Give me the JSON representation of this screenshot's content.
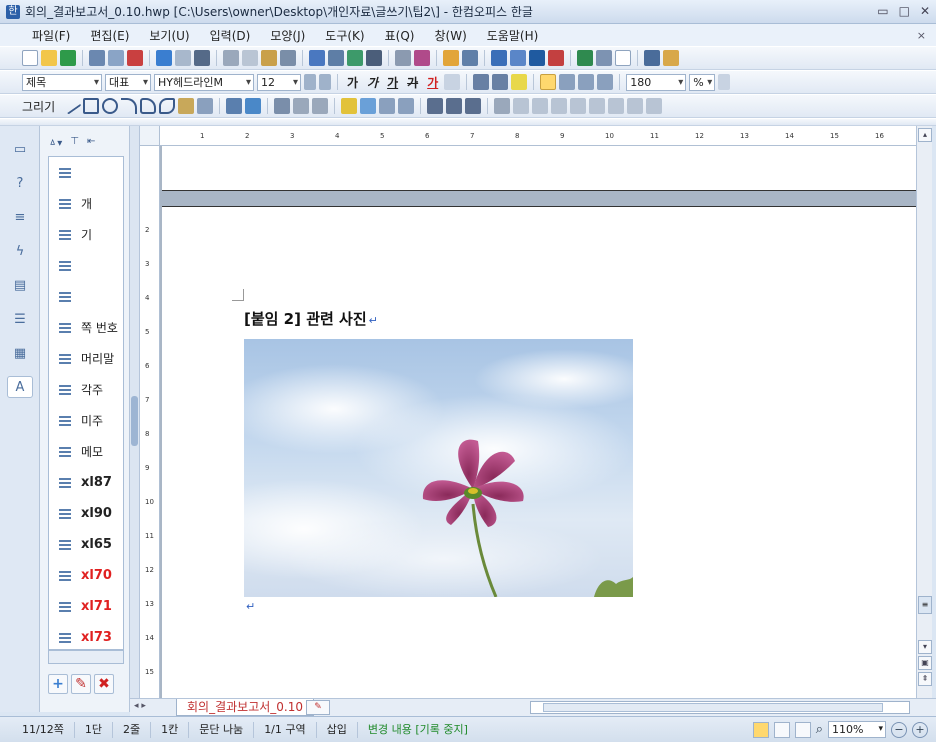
{
  "window": {
    "title": "회의_결과보고서_0.10.hwp [C:\\Users\\owner\\Desktop\\개인자료\\글쓰기\\팁2\\] - 한컴오피스 한글",
    "min_glyph": "▭",
    "max_glyph": "□",
    "close_glyph": "✕"
  },
  "menu": {
    "items": [
      "파일(F)",
      "편집(E)",
      "보기(U)",
      "입력(D)",
      "모양(J)",
      "도구(K)",
      "표(Q)",
      "창(W)",
      "도움말(H)"
    ],
    "close_doc": "×"
  },
  "format_toolbar": {
    "style": "제목",
    "lang": "대표",
    "font": "HY헤드라인M",
    "size": "12",
    "bold": "가",
    "italic": "가",
    "underline": "가",
    "strike": "가",
    "color_char": "가",
    "line_spacing": "180",
    "percent": "%"
  },
  "draw_toolbar": {
    "label": "그리기"
  },
  "style_panel": {
    "items": [
      {
        "label": "",
        "style": "normal"
      },
      {
        "label": "개",
        "style": "normal"
      },
      {
        "label": "기",
        "style": "normal"
      },
      {
        "label": "",
        "style": "normal"
      },
      {
        "label": "",
        "style": "normal"
      },
      {
        "label": "쪽 번호",
        "style": "normal"
      },
      {
        "label": "머리말",
        "style": "normal"
      },
      {
        "label": "각주",
        "style": "normal"
      },
      {
        "label": "미주",
        "style": "normal"
      },
      {
        "label": "메모",
        "style": "normal"
      },
      {
        "label": "xl87",
        "style": "bold"
      },
      {
        "label": "xl90",
        "style": "bold"
      },
      {
        "label": "xl65",
        "style": "bold"
      },
      {
        "label": "xl70",
        "style": "red"
      },
      {
        "label": "xl71",
        "style": "red"
      },
      {
        "label": "xl73",
        "style": "red"
      }
    ],
    "add_btn": "+",
    "edit_btn": "✎",
    "delete_btn": "✖"
  },
  "document": {
    "heading": "[붙임 2] 관련 사진",
    "para_mark": "↵",
    "after_mark": "↵"
  },
  "tabs": {
    "doc_tab": "회의_결과보고서_0.10",
    "new_tab": "✎"
  },
  "status": {
    "page": "11/12쪽",
    "column": "1단",
    "line": "2줄",
    "col": "1칸",
    "break": "문단 나눔",
    "section": "1/1 구역",
    "insert": "삽입",
    "track": "변경 내용 [기록 중지]",
    "zoom": "110%",
    "zoom_minus": "−",
    "zoom_plus": "+"
  },
  "ruler": {
    "h_numbers": [
      "1",
      "2",
      "3",
      "4",
      "5",
      "6",
      "7",
      "8",
      "9",
      "10",
      "11",
      "12",
      "13",
      "14",
      "15",
      "16"
    ],
    "v_numbers": [
      "2",
      "3",
      "4",
      "5",
      "6",
      "7",
      "8",
      "9",
      "10",
      "11",
      "12",
      "13",
      "14",
      "15"
    ]
  },
  "colors": {
    "accent": "#2b5fa8",
    "red_style": "#e02020",
    "status_green": "#208a2a",
    "tab_red": "#c03030"
  }
}
